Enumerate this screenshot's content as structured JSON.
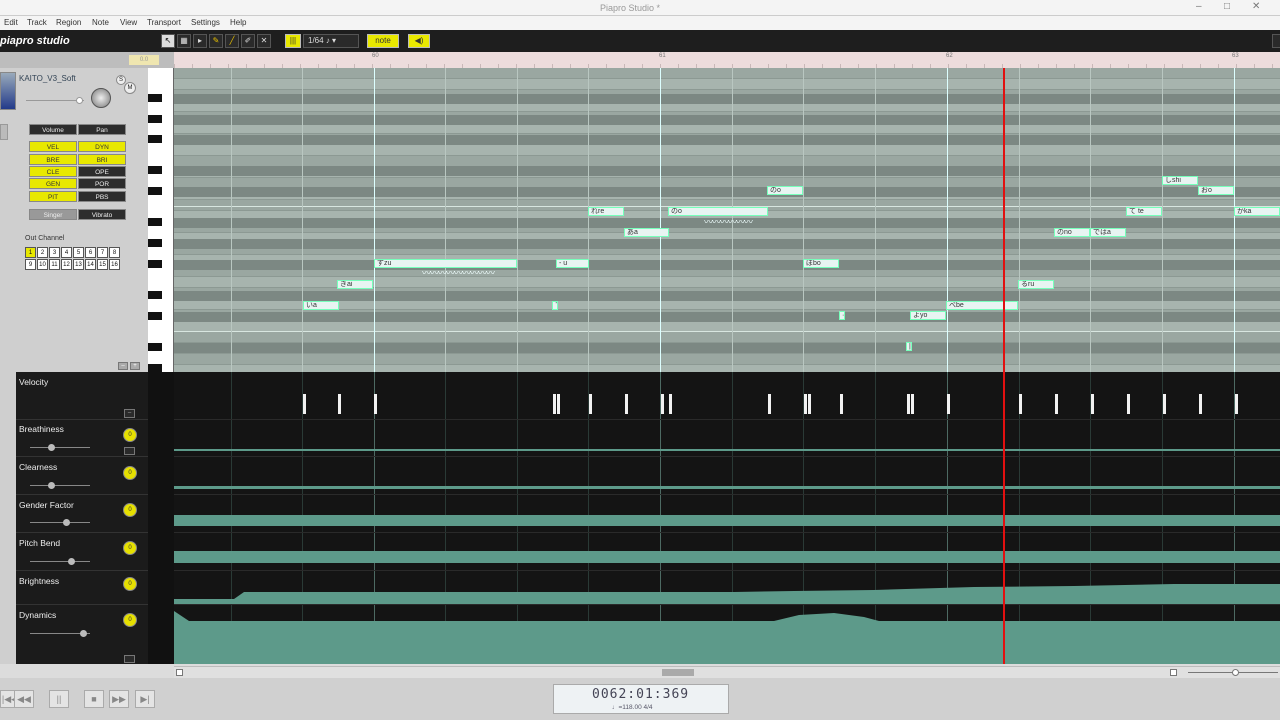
{
  "window": {
    "title": "Piapro Studio *"
  },
  "menu": [
    "Edit",
    "Track",
    "Region",
    "Note",
    "View",
    "Transport",
    "Settings",
    "Help"
  ],
  "toolbar": {
    "logo": "piapro studio",
    "quantize": "1/64",
    "quantize_unit": "♪",
    "note_btn": "note ——",
    "speaker_btn": "◀)"
  },
  "ruler": {
    "marks": [
      "60",
      "61",
      "62",
      "63"
    ],
    "marker": "0.0"
  },
  "track": {
    "voicebank": "KAITO_V3_Soft",
    "solo": "S",
    "mute": "M",
    "volume_btn": "Volume",
    "pan_btn": "Pan",
    "params": [
      [
        "VEL",
        "DYN"
      ],
      [
        "BRE",
        "BRI"
      ],
      [
        "CLE",
        "OPE"
      ],
      [
        "GEN",
        "POR"
      ],
      [
        "PIT",
        "PBS"
      ]
    ],
    "singer_btn": "Singer",
    "vibrato_btn": "Vibrato",
    "out_channel_label": "Out Channel",
    "channels": [
      "1",
      "2",
      "3",
      "4",
      "5",
      "6",
      "7",
      "8",
      "9",
      "10",
      "11",
      "12",
      "13",
      "14",
      "15",
      "16"
    ]
  },
  "notes": [
    {
      "lyric": "いa"
    },
    {
      "lyric": "きai"
    },
    {
      "lyric": "ずzu"
    },
    {
      "lyric": "- u"
    },
    {
      "lyric": "す"
    },
    {
      "lyric": "れre"
    },
    {
      "lyric": "あa"
    },
    {
      "lyric": "のo"
    },
    {
      "lyric": "のo"
    },
    {
      "lyric": "ぼbo"
    },
    {
      "lyric": "·"
    },
    {
      "lyric": "よyo"
    },
    {
      "lyric": "|"
    },
    {
      "lyric": "べbe"
    },
    {
      "lyric": "るru"
    },
    {
      "lyric": "のno"
    },
    {
      "lyric": "ではa"
    },
    {
      "lyric": "て te"
    },
    {
      "lyric": "しshi"
    },
    {
      "lyric": "おo"
    },
    {
      "lyric": "かka"
    }
  ],
  "controllers": [
    {
      "name": "Velocity",
      "knob": ""
    },
    {
      "name": "Breathiness",
      "knob": "0"
    },
    {
      "name": "Clearness",
      "knob": "0"
    },
    {
      "name": "Gender Factor",
      "knob": "0"
    },
    {
      "name": "Pitch Bend",
      "knob": "0"
    },
    {
      "name": "Brightness",
      "knob": "0"
    },
    {
      "name": "Dynamics",
      "knob": "0"
    }
  ],
  "transport": {
    "buttons": [
      "|◀◀",
      "◀◀",
      "||",
      "■",
      "▶▶",
      "▶|"
    ],
    "time": "0062:01:369",
    "tempo_sig": "♩=118.00  4/4"
  }
}
